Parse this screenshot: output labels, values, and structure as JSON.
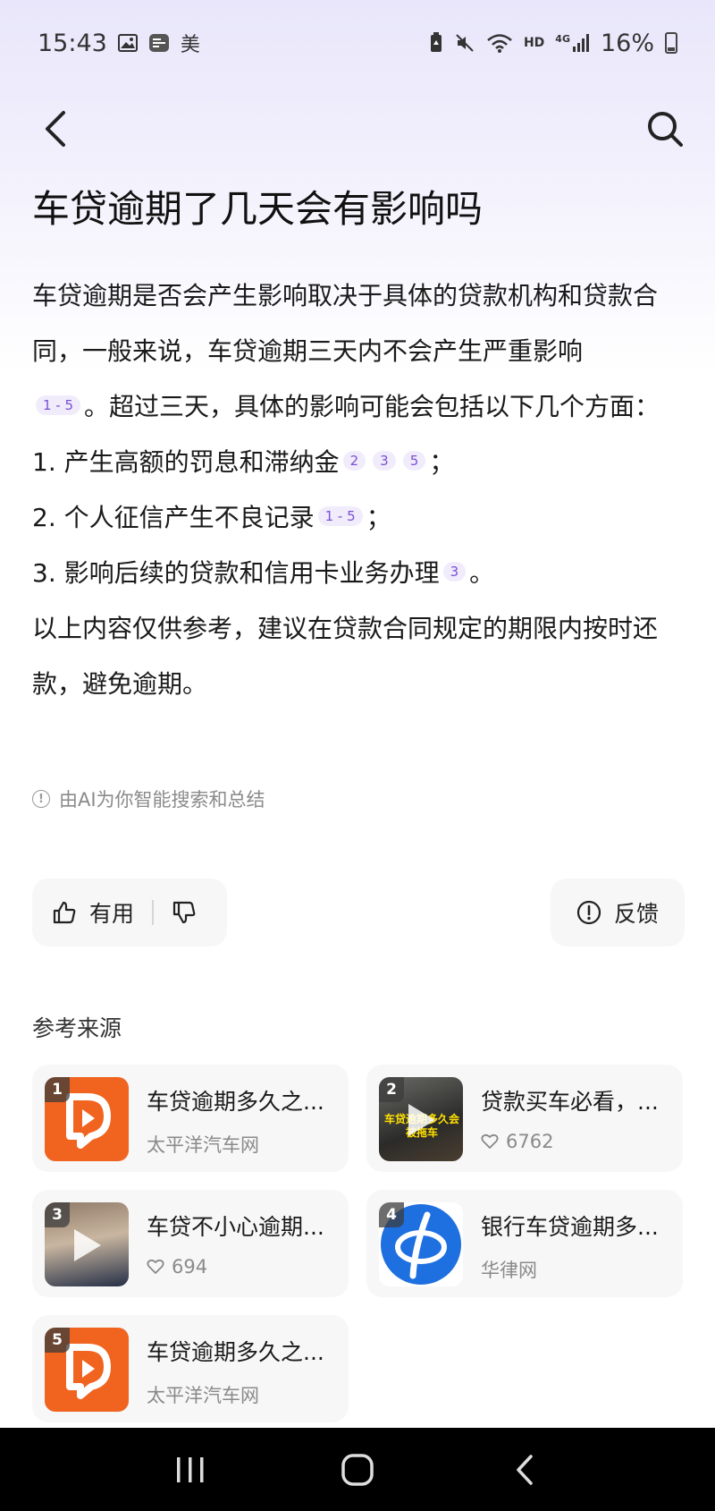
{
  "status_bar": {
    "time": "15:43",
    "carrier_badge": "美",
    "network_hd": "HD",
    "network_gen": "4G",
    "battery": "16%"
  },
  "header": {
    "title": "车贷逾期了几天会有影响吗"
  },
  "answer": {
    "intro_part1": "车贷逾期是否会产生影响取决于具体的贷款机构和贷款合同，一般来说，车贷逾期三天内不会产生严重影响",
    "intro_cite": "1 - 5",
    "intro_part2": "。超过三天，具体的影响可能会包括以下几个方面：",
    "items": [
      {
        "text": "1.  产生高额的罚息和滞纳金",
        "cites": [
          "2",
          "3",
          "5"
        ],
        "end": "；"
      },
      {
        "text": "2.  个人征信产生不良记录",
        "cites": [
          "1 - 5"
        ],
        "end": "；"
      },
      {
        "text": "3.  影响后续的贷款和信用卡业务办理",
        "cites": [
          "3"
        ],
        "end": "。"
      }
    ],
    "conclusion": "以上内容仅供参考，建议在贷款合同规定的期限内按时还款，避免逾期。",
    "ai_note": "由AI为你智能搜索和总结"
  },
  "actions": {
    "useful_label": "有用",
    "feedback_label": "反馈"
  },
  "sources": {
    "title": "参考来源",
    "items": [
      {
        "index": "1",
        "title": "车贷逾期多久之...",
        "meta": "太平洋汽车网",
        "likes": null
      },
      {
        "index": "2",
        "title": "贷款买车必看，...",
        "meta": null,
        "likes": "6762",
        "caption": "车贷逾期多久会被拖车"
      },
      {
        "index": "3",
        "title": "车贷不小心逾期...",
        "meta": null,
        "likes": "694"
      },
      {
        "index": "4",
        "title": "银行车贷逾期多...",
        "meta": "华律网",
        "likes": null
      },
      {
        "index": "5",
        "title": "车贷逾期多久之...",
        "meta": "太平洋汽车网",
        "likes": null
      }
    ]
  },
  "colors": {
    "accent_purple": "#7a4fd6",
    "pconline_orange": "#f0641f",
    "lawtime_blue": "#1e6fe0"
  }
}
